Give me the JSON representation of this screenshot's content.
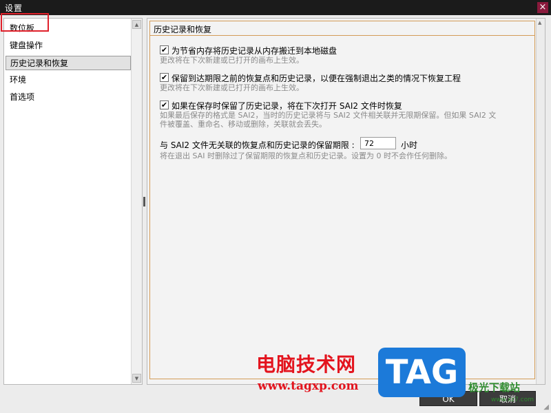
{
  "window": {
    "title": "设置",
    "close_glyph": "×"
  },
  "sidebar": {
    "items": [
      {
        "label": "数位板",
        "selected": false
      },
      {
        "label": "键盘操作",
        "selected": false
      },
      {
        "label": "历史记录和恢复",
        "selected": true
      },
      {
        "label": "环境",
        "selected": false
      },
      {
        "label": "首选项",
        "selected": false
      }
    ]
  },
  "main": {
    "section_title": "历史记录和恢复",
    "options": [
      {
        "checked": true,
        "label": "为节省内存将历史记录从内存搬迁到本地磁盘",
        "desc": "更改将在下次新建或已打开的画布上生效。"
      },
      {
        "checked": true,
        "label": "保留到达期限之前的恢复点和历史记录，以便在强制退出之类的情况下恢复工程",
        "desc": "更改将在下次新建或已打开的画布上生效。"
      },
      {
        "checked": true,
        "label": "如果在保存时保留了历史记录，将在下次打开 SAI2 文件时恢复",
        "desc_line1": "如果最后保存的格式是 SAI2，当时的历史记录将与 SAI2 文件相关联并无限期保留。但如果 SAI2 文",
        "desc_line2": "件被覆盖、重命名、移动或删除，关联就会丢失。"
      }
    ],
    "retention": {
      "label": "与 SAI2 文件无关联的恢复点和历史记录的保留期限 :",
      "value": "72",
      "unit": "小时",
      "desc": "将在退出 SAI 时删除过了保留期限的恢复点和历史记录。设置为 0 时不会作任何删除。"
    }
  },
  "buttons": {
    "ok": "OK",
    "cancel": "取消"
  },
  "watermark": {
    "site_name": "电脑技术网",
    "url": "www.tagxp.com",
    "tag": "TAG",
    "logo": "极光下载站",
    "logo_sub": "www.xz7.com"
  },
  "colors": {
    "accent_frame": "#d39b55",
    "highlight": "#e0202a"
  },
  "icons": {
    "close": "close-icon",
    "check": "check-icon",
    "scroll_up": "scroll-up-icon",
    "scroll_down": "scroll-down-icon"
  }
}
